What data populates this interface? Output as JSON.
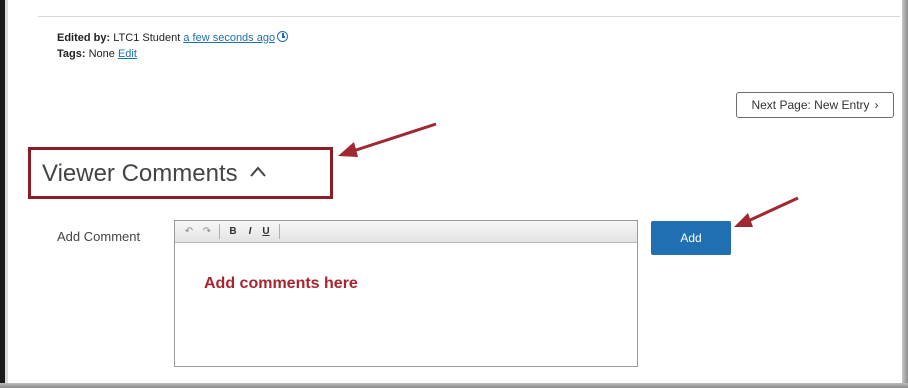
{
  "meta": {
    "edited_by_label": "Edited by:",
    "edited_by_user": "LTC1 Student",
    "edited_time": "a few seconds ago",
    "tags_label": "Tags:",
    "tags_value": "None",
    "edit_link": "Edit"
  },
  "navigation": {
    "next_page_label": "Next Page: New Entry",
    "next_page_chevron": "›"
  },
  "comments": {
    "section_title": "Viewer Comments",
    "add_comment_label": "Add Comment",
    "add_button_label": "Add",
    "editor_hint": "Add comments here",
    "toolbar": {
      "undo": "↶",
      "redo": "↷",
      "bold": "B",
      "italic": "I",
      "underline": "U"
    }
  },
  "colors": {
    "link": "#1f6fb2",
    "accent_button": "#1f6fb2",
    "highlight_box": "#8b1d24",
    "annotation_arrow": "#a02830",
    "hint_text": "#a8242f"
  },
  "icons": {
    "clock": "clock-icon",
    "caret_up": "chevron-up-icon",
    "arrow_annotation": "arrow-icon"
  }
}
